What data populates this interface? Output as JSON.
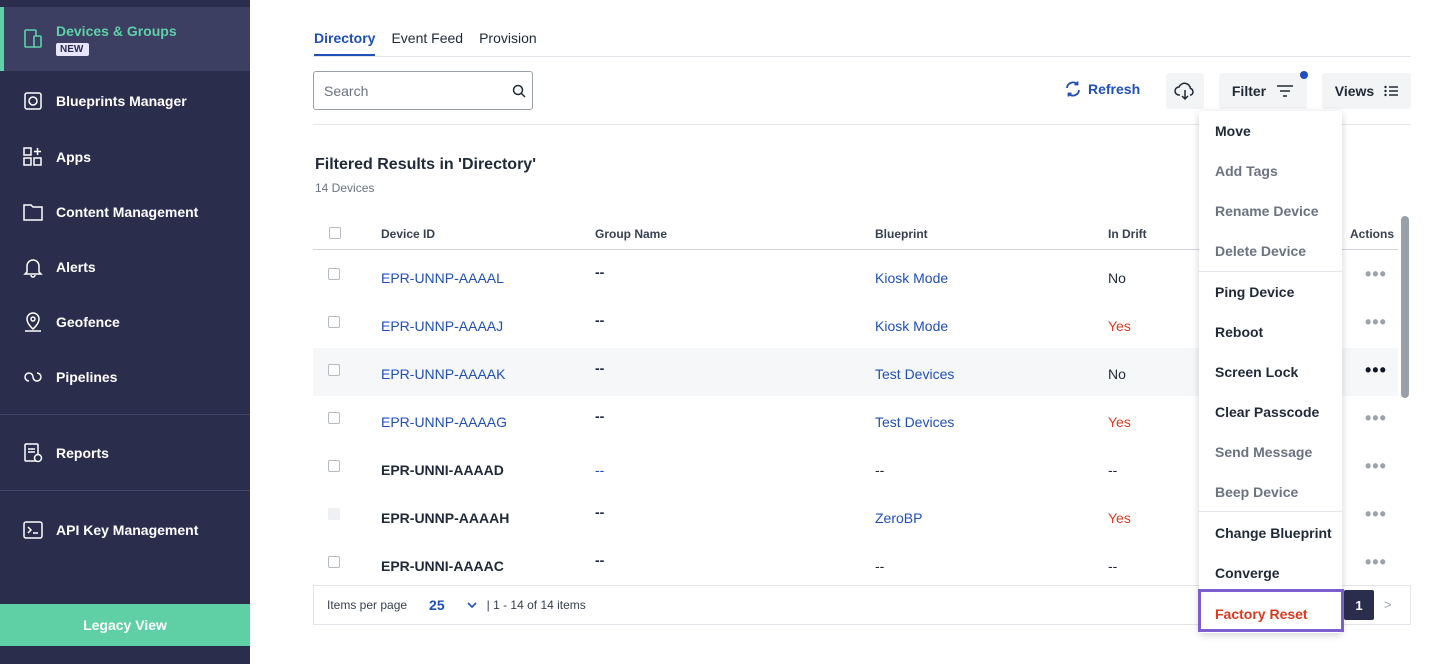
{
  "sidebar": {
    "items": [
      {
        "label": "Devices & Groups",
        "badge": "NEW",
        "icon": "devices-icon"
      },
      {
        "label": "Blueprints Manager",
        "icon": "blueprint-icon"
      },
      {
        "label": "Apps",
        "icon": "apps-icon"
      },
      {
        "label": "Content Management",
        "icon": "folder-icon"
      },
      {
        "label": "Alerts",
        "icon": "bell-icon"
      },
      {
        "label": "Geofence",
        "icon": "location-icon"
      },
      {
        "label": "Pipelines",
        "icon": "pipeline-icon"
      },
      {
        "label": "Reports",
        "icon": "report-icon"
      },
      {
        "label": "API Key Management",
        "icon": "terminal-icon"
      }
    ],
    "legacy_label": "Legacy View"
  },
  "tabs": [
    "Directory",
    "Event Feed",
    "Provision"
  ],
  "search": {
    "placeholder": "Search"
  },
  "toolbar": {
    "refresh": "Refresh",
    "filter": "Filter",
    "views": "Views"
  },
  "results": {
    "title": "Filtered Results in 'Directory'",
    "count": "14 Devices"
  },
  "table": {
    "headers": [
      "Device ID",
      "Group Name",
      "Blueprint",
      "In Drift",
      "Actions"
    ],
    "rows": [
      {
        "id": "EPR-UNNP-AAAAL",
        "group": "--",
        "blueprint": "Kiosk Mode",
        "drift": "No"
      },
      {
        "id": "EPR-UNNP-AAAAJ",
        "group": "--",
        "blueprint": "Kiosk Mode",
        "drift": "Yes"
      },
      {
        "id": "EPR-UNNP-AAAAK",
        "group": "--",
        "blueprint": "Test Devices",
        "drift": "No"
      },
      {
        "id": "EPR-UNNP-AAAAG",
        "group": "--",
        "blueprint": "Test Devices",
        "drift": "Yes"
      },
      {
        "id": "EPR-UNNI-AAAAD",
        "group": "--",
        "blueprint": "--",
        "drift": "--"
      },
      {
        "id": "EPR-UNNP-AAAAH",
        "group": "--",
        "blueprint": "ZeroBP",
        "drift": "Yes"
      },
      {
        "id": "EPR-UNNI-AAAAC",
        "group": "--",
        "blueprint": "--",
        "drift": "--"
      }
    ]
  },
  "footer": {
    "items_per_page_label": "Items per page",
    "items_per_page_value": "25",
    "range": "| 1 - 14 of 14 items",
    "page": "1",
    "next": ">"
  },
  "actions_menu": {
    "items": [
      "Move",
      "Add Tags",
      "Rename Device",
      "Delete Device",
      "Ping Device",
      "Reboot",
      "Screen Lock",
      "Clear Passcode",
      "Send Message",
      "Beep Device",
      "Change Blueprint",
      "Converge",
      "Factory Reset"
    ]
  },
  "colors": {
    "sidebar": "#2b2d4d",
    "accent": "#5fd1a8",
    "link": "#1f4fb8",
    "danger": "#d63a1f",
    "highlight": "#7b5fd1"
  }
}
